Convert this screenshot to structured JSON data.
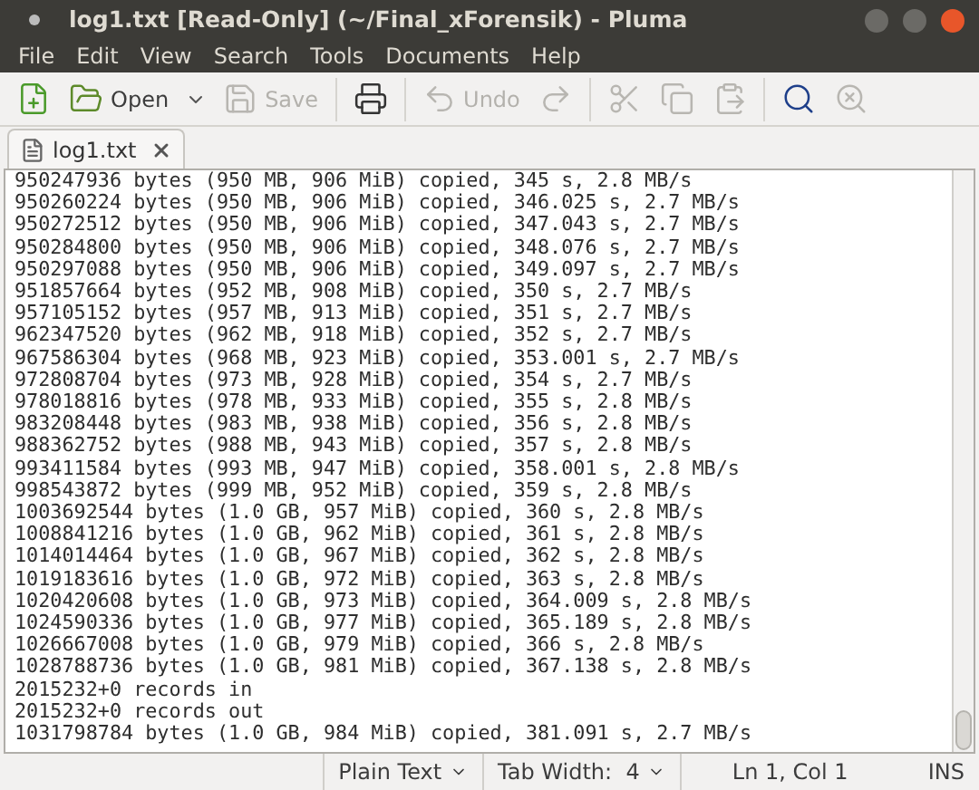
{
  "window": {
    "title": "log1.txt [Read-Only] (~/Final_xForensik) - Pluma"
  },
  "menu": [
    "File",
    "Edit",
    "View",
    "Search",
    "Tools",
    "Documents",
    "Help"
  ],
  "toolbar": [
    {
      "kind": "new",
      "disabled": false
    },
    {
      "kind": "open",
      "label": "Open",
      "disabled": false
    },
    {
      "kind": "save",
      "label": "Save",
      "disabled": true
    },
    {
      "kind": "sep"
    },
    {
      "kind": "print",
      "disabled": false
    },
    {
      "kind": "sep"
    },
    {
      "kind": "undo",
      "label": "Undo",
      "disabled": true
    },
    {
      "kind": "redo",
      "disabled": true
    },
    {
      "kind": "sep"
    },
    {
      "kind": "cut",
      "disabled": true
    },
    {
      "kind": "copy",
      "disabled": true
    },
    {
      "kind": "paste",
      "disabled": true
    },
    {
      "kind": "sep"
    },
    {
      "kind": "find",
      "disabled": false
    },
    {
      "kind": "replace",
      "disabled": true
    }
  ],
  "tabs": [
    {
      "label": "log1.txt",
      "selected": true
    }
  ],
  "lines": [
    "950247936 bytes (950 MB, 906 MiB) copied, 345 s, 2.8 MB/s",
    "950260224 bytes (950 MB, 906 MiB) copied, 346.025 s, 2.7 MB/s",
    "950272512 bytes (950 MB, 906 MiB) copied, 347.043 s, 2.7 MB/s",
    "950284800 bytes (950 MB, 906 MiB) copied, 348.076 s, 2.7 MB/s",
    "950297088 bytes (950 MB, 906 MiB) copied, 349.097 s, 2.7 MB/s",
    "951857664 bytes (952 MB, 908 MiB) copied, 350 s, 2.7 MB/s",
    "957105152 bytes (957 MB, 913 MiB) copied, 351 s, 2.7 MB/s",
    "962347520 bytes (962 MB, 918 MiB) copied, 352 s, 2.7 MB/s",
    "967586304 bytes (968 MB, 923 MiB) copied, 353.001 s, 2.7 MB/s",
    "972808704 bytes (973 MB, 928 MiB) copied, 354 s, 2.7 MB/s",
    "978018816 bytes (978 MB, 933 MiB) copied, 355 s, 2.8 MB/s",
    "983208448 bytes (983 MB, 938 MiB) copied, 356 s, 2.8 MB/s",
    "988362752 bytes (988 MB, 943 MiB) copied, 357 s, 2.8 MB/s",
    "993411584 bytes (993 MB, 947 MiB) copied, 358.001 s, 2.8 MB/s",
    "998543872 bytes (999 MB, 952 MiB) copied, 359 s, 2.8 MB/s",
    "1003692544 bytes (1.0 GB, 957 MiB) copied, 360 s, 2.8 MB/s",
    "1008841216 bytes (1.0 GB, 962 MiB) copied, 361 s, 2.8 MB/s",
    "1014014464 bytes (1.0 GB, 967 MiB) copied, 362 s, 2.8 MB/s",
    "1019183616 bytes (1.0 GB, 972 MiB) copied, 363 s, 2.8 MB/s",
    "1020420608 bytes (1.0 GB, 973 MiB) copied, 364.009 s, 2.8 MB/s",
    "1024590336 bytes (1.0 GB, 977 MiB) copied, 365.189 s, 2.8 MB/s",
    "1026667008 bytes (1.0 GB, 979 MiB) copied, 366 s, 2.8 MB/s",
    "1028788736 bytes (1.0 GB, 981 MiB) copied, 367.138 s, 2.8 MB/s",
    "2015232+0 records in",
    "2015232+0 records out",
    "1031798784 bytes (1.0 GB, 984 MiB) copied, 381.091 s, 2.7 MB/s"
  ],
  "status_bar": {
    "language": "Plain Text",
    "tab_width": "Tab Width:  4",
    "position": "Ln 1, Col 1",
    "mode": "INS"
  }
}
